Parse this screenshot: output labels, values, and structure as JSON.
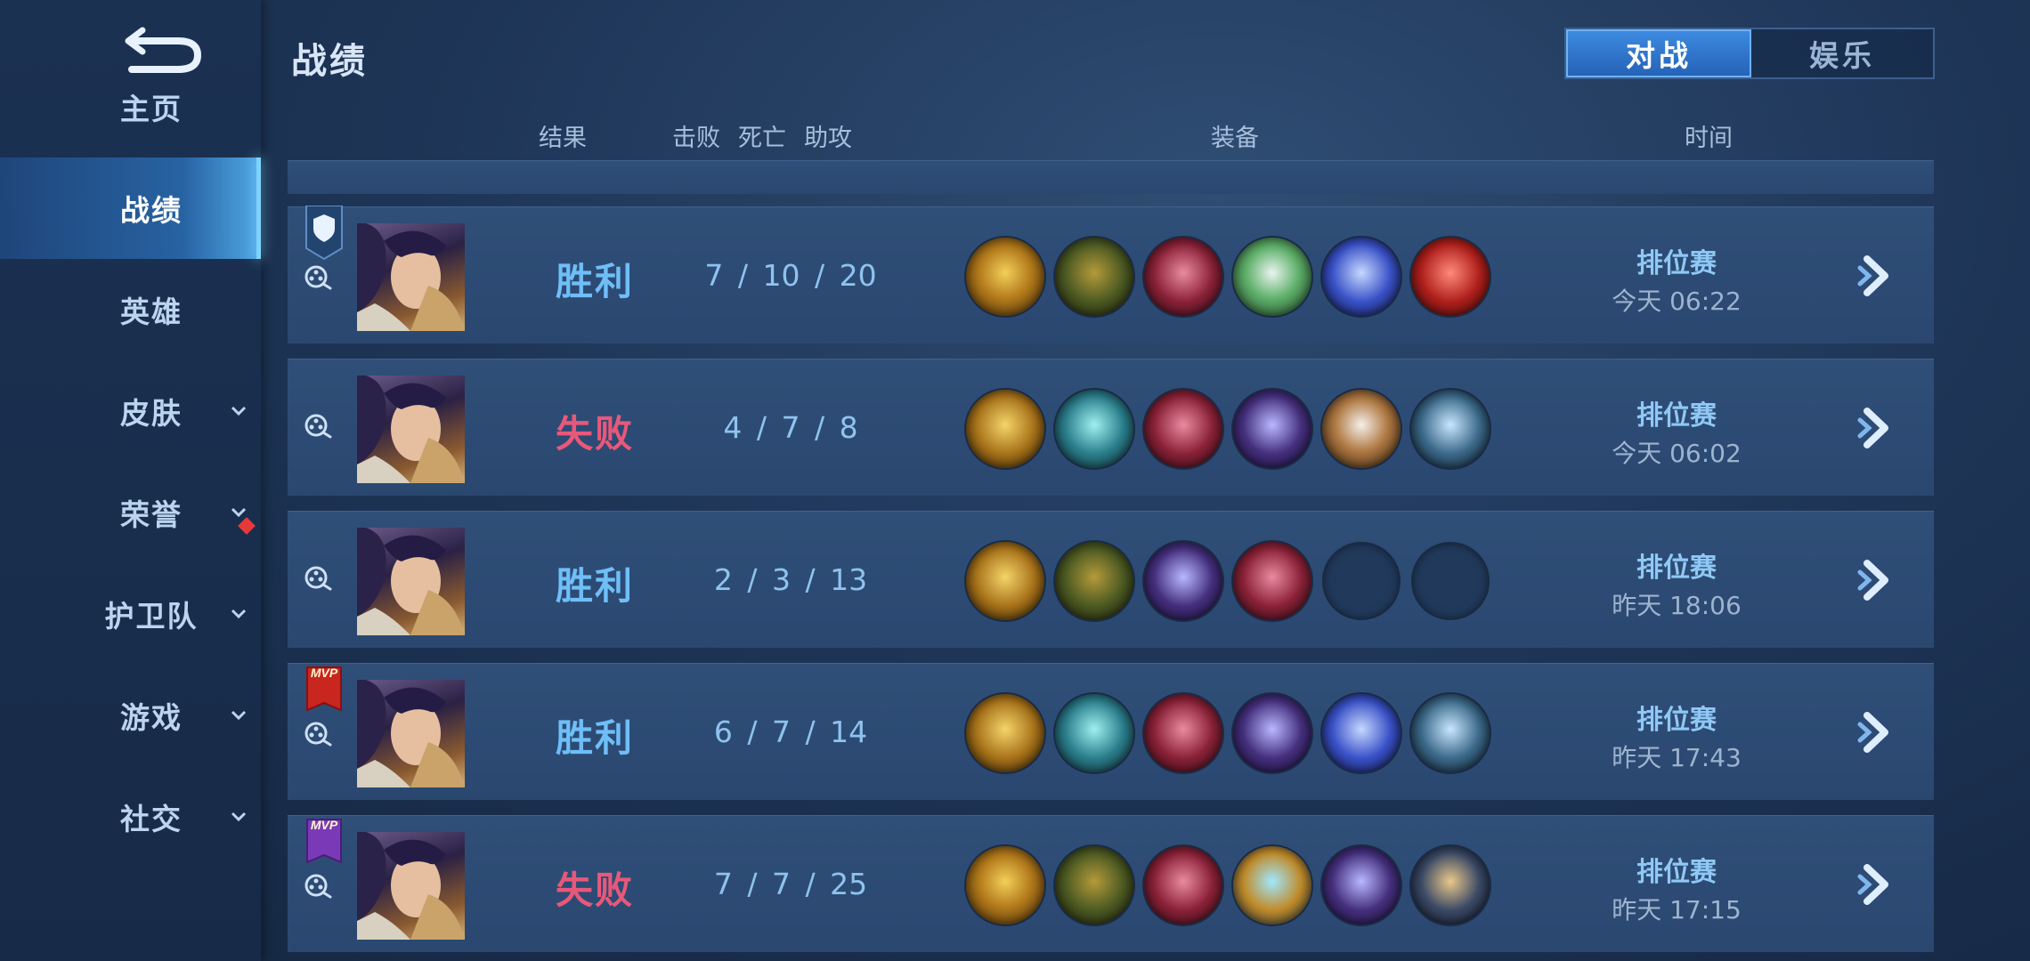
{
  "sidebar": {
    "items": [
      {
        "label": "主页",
        "active": false,
        "chevron": false
      },
      {
        "label": "战绩",
        "active": true,
        "chevron": false
      },
      {
        "label": "英雄",
        "active": false,
        "chevron": false
      },
      {
        "label": "皮肤",
        "active": false,
        "chevron": true
      },
      {
        "label": "荣誉",
        "active": false,
        "chevron": true
      },
      {
        "label": "护卫队",
        "active": false,
        "chevron": true
      },
      {
        "label": "游戏",
        "active": false,
        "chevron": true
      },
      {
        "label": "社交",
        "active": false,
        "chevron": true
      }
    ]
  },
  "header": {
    "title": "战绩",
    "tabs": [
      {
        "label": "对战",
        "active": true
      },
      {
        "label": "娱乐",
        "active": false
      }
    ]
  },
  "columns": {
    "result": "结果",
    "kills": "击败",
    "deaths": "死亡",
    "assists": "助攻",
    "equipment": "装备",
    "time": "时间"
  },
  "matches": [
    {
      "badge": "shield",
      "result": "胜利",
      "win": true,
      "kda": "7 / 10 / 20",
      "mode": "排位赛",
      "time": "今天 06:22",
      "items": [
        "gold-armor",
        "green-boots",
        "red-spike-armor",
        "green-orb",
        "blue-blade",
        "red-helmet"
      ]
    },
    {
      "badge": "",
      "result": "失败",
      "win": false,
      "kda": "4 / 7 / 8",
      "mode": "排位赛",
      "time": "今天 06:02",
      "items": [
        "gold-shield",
        "teal-boots",
        "red-spike-armor",
        "purple-cloak",
        "brown-vest",
        "silver-belt"
      ]
    },
    {
      "badge": "",
      "result": "胜利",
      "win": true,
      "kda": "2 / 3 / 13",
      "mode": "排位赛",
      "time": "昨天 18:06",
      "items": [
        "gold-shield",
        "green-boots",
        "purple-cloak",
        "red-spike-armor",
        "",
        ""
      ]
    },
    {
      "badge": "mvp-red",
      "result": "胜利",
      "win": true,
      "kda": "6 / 7 / 14",
      "mode": "排位赛",
      "time": "昨天 17:43",
      "items": [
        "gold-shield",
        "teal-boots",
        "red-spike-armor",
        "purple-cloak",
        "blue-blade",
        "silver-belt"
      ]
    },
    {
      "badge": "mvp-purple",
      "result": "失败",
      "win": false,
      "kda": "7 / 7 / 25",
      "mode": "排位赛",
      "time": "昨天 17:15",
      "items": [
        "gold-armor",
        "green-boots",
        "red-spike-armor",
        "gold-gem",
        "purple-cloak",
        "dark-gauntlet"
      ]
    }
  ],
  "badges": {
    "mvp": "MVP"
  },
  "colors": {
    "win": "#6fbef7",
    "loss": "#e8587a",
    "accent": "#3d8ae0"
  }
}
